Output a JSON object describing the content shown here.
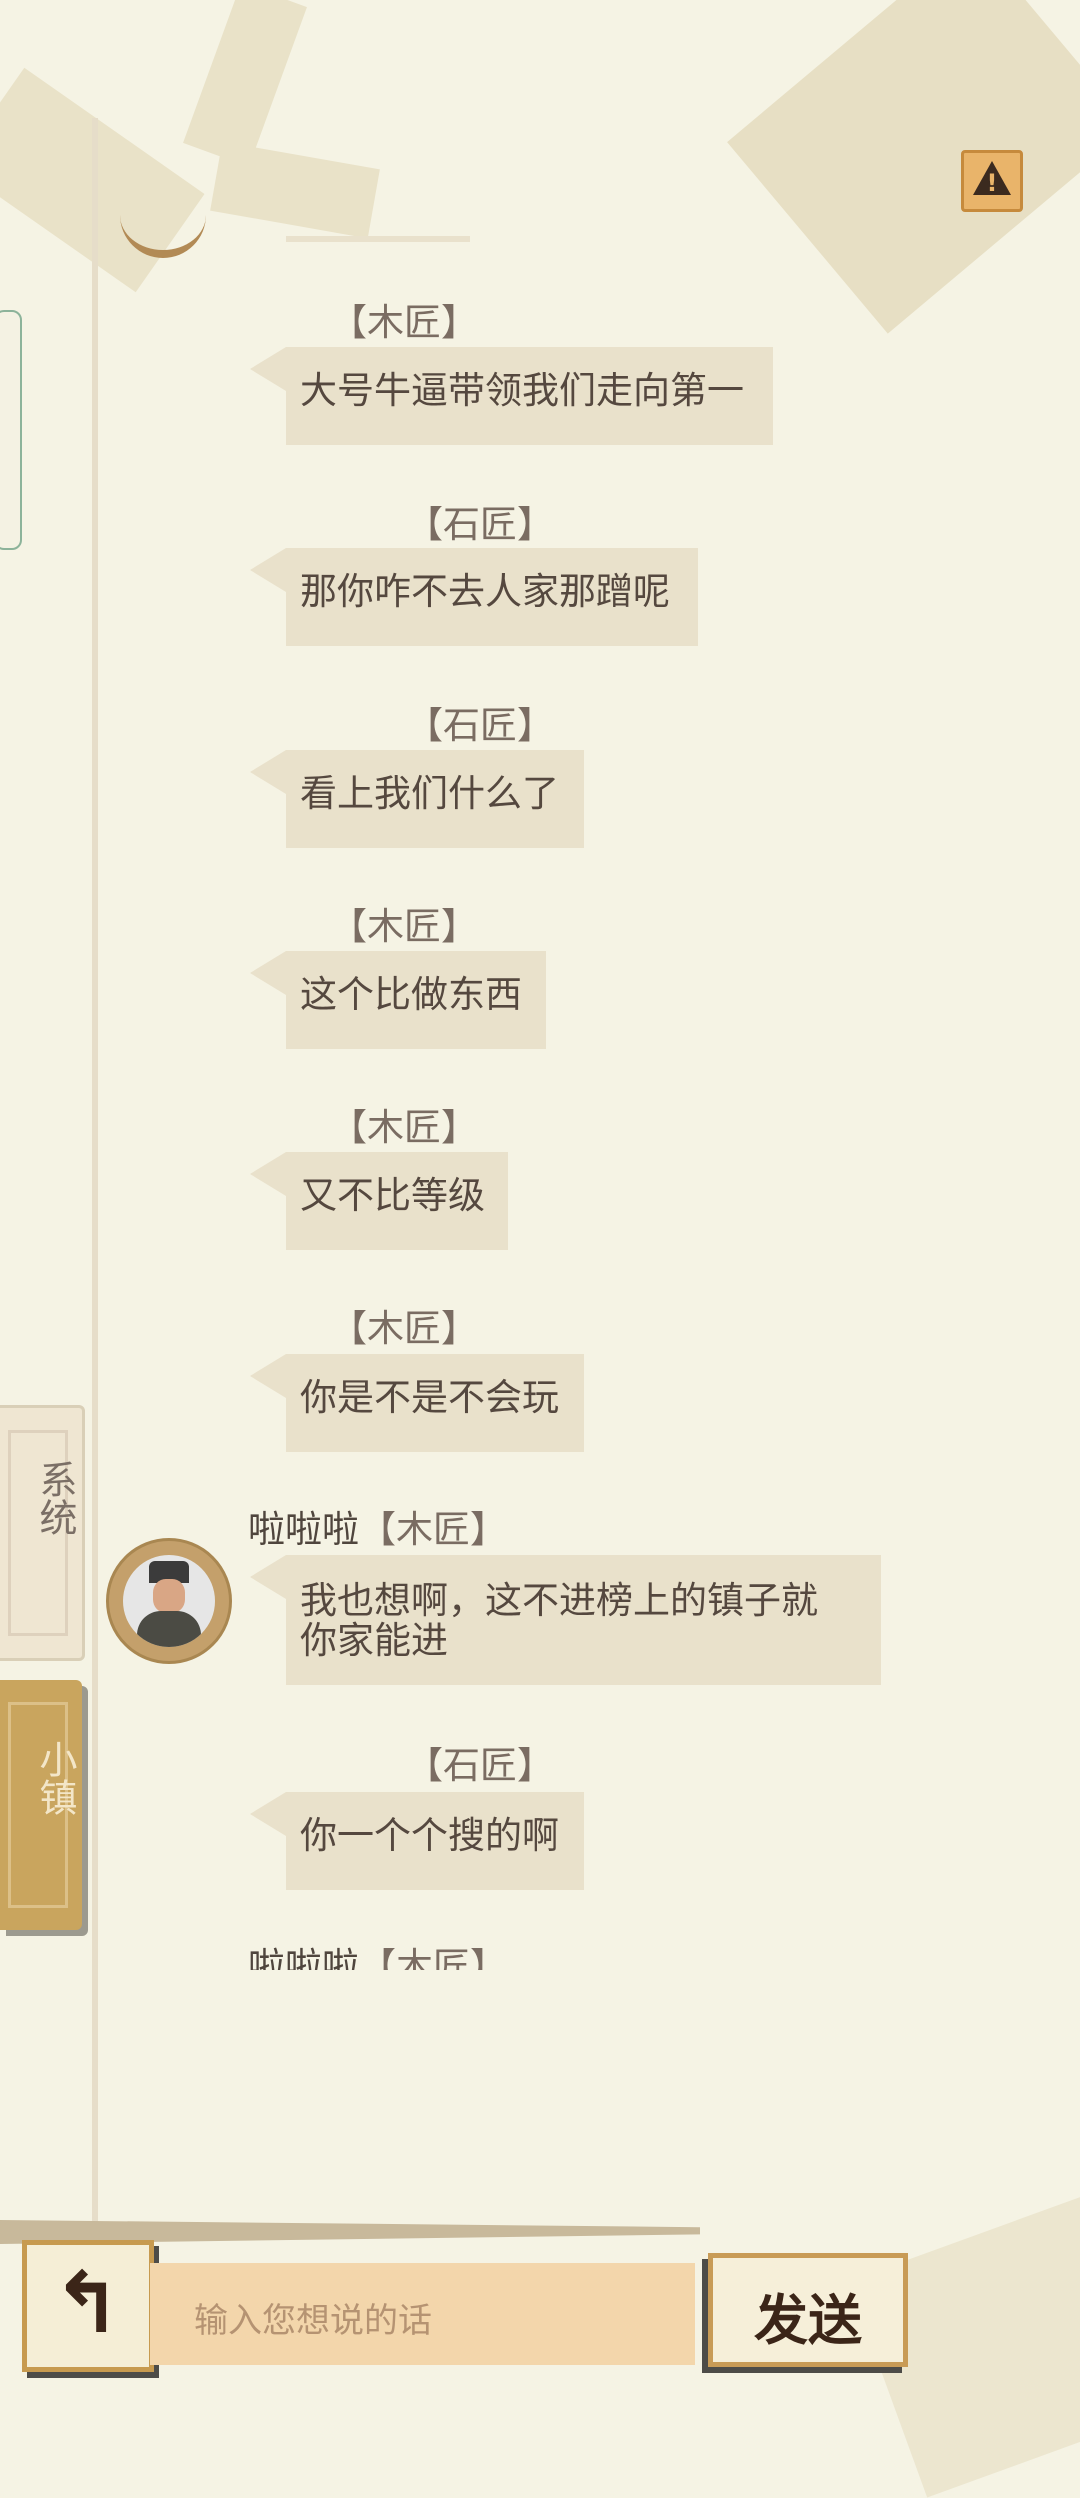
{
  "tabs": [
    {
      "label": "系统"
    },
    {
      "label": "小镇"
    }
  ],
  "messages": [
    {
      "sender": "",
      "tag": "【木匠】",
      "text": "大号牛逼带领我们走向第一"
    },
    {
      "sender": "",
      "tag": "【石匠】",
      "text": "那你咋不去人家那蹭呢"
    },
    {
      "sender": "",
      "tag": "【石匠】",
      "text": "看上我们什么了"
    },
    {
      "sender": "",
      "tag": "【木匠】",
      "text": "这个比做东西"
    },
    {
      "sender": "",
      "tag": "【木匠】",
      "text": "又不比等级"
    },
    {
      "sender": "",
      "tag": "【木匠】",
      "text": "你是不是不会玩"
    },
    {
      "sender": "啦啦啦",
      "tag": "【木匠】",
      "text": "我也想啊，这不进榜上的镇子就你家能进"
    },
    {
      "sender": "",
      "tag": "【石匠】",
      "text": "你一个个搜的啊"
    },
    {
      "sender": "啦啦啦",
      "tag": "【木匠】",
      "text": ""
    }
  ],
  "input": {
    "placeholder": "输入您想说的话"
  },
  "send_button": {
    "label": "发送"
  },
  "icons": {
    "warning": "warning-icon",
    "back": "back-arrow-icon"
  }
}
